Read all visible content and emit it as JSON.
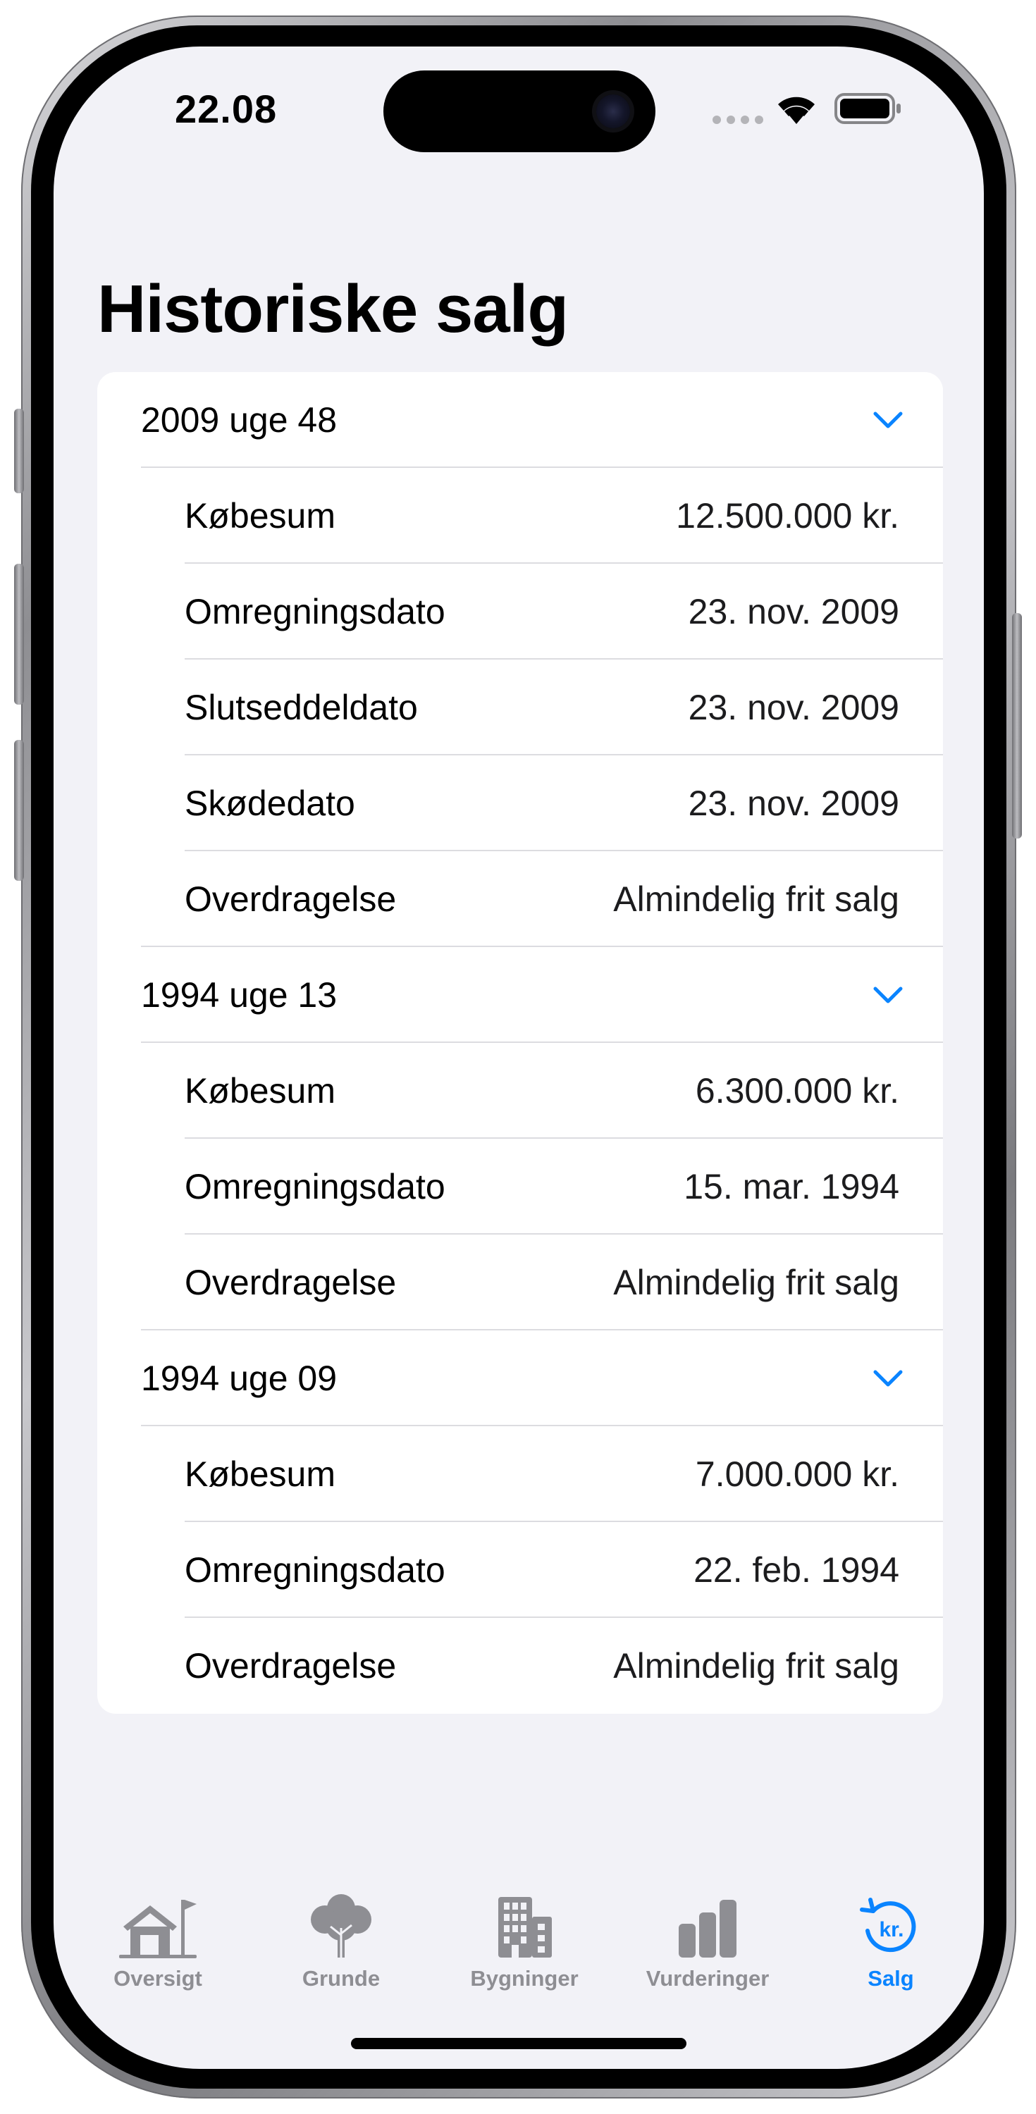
{
  "status_bar": {
    "time": "22.08"
  },
  "page": {
    "title": "Historiske salg"
  },
  "sales": [
    {
      "label": "2009 uge 48",
      "expanded": true,
      "details": [
        {
          "label": "Købesum",
          "value": "12.500.000 kr."
        },
        {
          "label": "Omregningsdato",
          "value": "23. nov. 2009"
        },
        {
          "label": "Slutseddeldato",
          "value": "23. nov. 2009"
        },
        {
          "label": "Skødedato",
          "value": "23. nov. 2009"
        },
        {
          "label": "Overdragelse",
          "value": "Almindelig frit salg"
        }
      ]
    },
    {
      "label": "1994 uge 13",
      "expanded": true,
      "details": [
        {
          "label": "Købesum",
          "value": "6.300.000 kr."
        },
        {
          "label": "Omregningsdato",
          "value": "15. mar. 1994"
        },
        {
          "label": "Overdragelse",
          "value": "Almindelig frit salg"
        }
      ]
    },
    {
      "label": "1994 uge 09",
      "expanded": true,
      "details": [
        {
          "label": "Købesum",
          "value": "7.000.000 kr."
        },
        {
          "label": "Omregningsdato",
          "value": "22. feb. 1994"
        },
        {
          "label": "Overdragelse",
          "value": "Almindelig frit salg"
        }
      ]
    }
  ],
  "tab_bar": {
    "tabs": [
      {
        "label": "Oversigt",
        "icon": "house-flag-icon",
        "active": false
      },
      {
        "label": "Grunde",
        "icon": "tree-icon",
        "active": false
      },
      {
        "label": "Bygninger",
        "icon": "building-icon",
        "active": false
      },
      {
        "label": "Vurderinger",
        "icon": "bar-chart-icon",
        "active": false
      },
      {
        "label": "Salg",
        "icon": "kr-circle-arrow-icon",
        "active": true
      }
    ]
  },
  "colors": {
    "accent": "#0a84ff",
    "tab_inactive": "#8e8e93",
    "background": "#f2f2f7",
    "card": "#ffffff",
    "separator": "#dcdce0"
  }
}
